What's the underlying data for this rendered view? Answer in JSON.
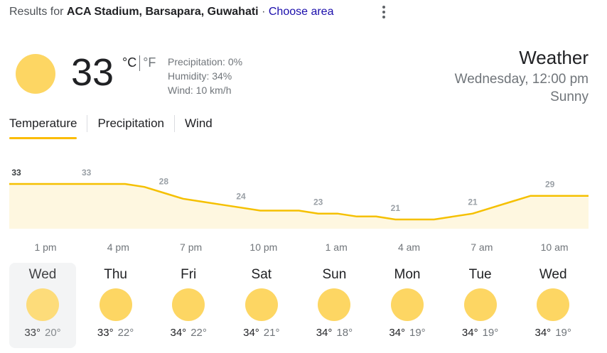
{
  "header": {
    "results_prefix": "Results for",
    "location": "ACA Stadium, Barsapara, Guwahati",
    "separator": "·",
    "choose_area": "Choose area",
    "more_icon": "more-vert-icon"
  },
  "current": {
    "icon": "sun-icon",
    "temperature": "33",
    "unit_c": "°C",
    "unit_f": "°F",
    "precipitation": "Precipitation: 0%",
    "humidity": "Humidity: 34%",
    "wind": "Wind: 10 km/h"
  },
  "summary": {
    "title": "Weather",
    "datetime": "Wednesday, 12:00 pm",
    "condition": "Sunny"
  },
  "tabs": [
    "Temperature",
    "Precipitation",
    "Wind"
  ],
  "chart_data": {
    "type": "area",
    "series": [
      {
        "values": [
          33,
          33,
          33,
          33,
          33,
          33,
          33,
          32,
          30,
          28,
          27,
          26,
          25,
          24,
          24,
          24,
          23,
          23,
          22,
          22,
          21,
          21,
          21,
          22,
          23,
          25,
          27,
          29,
          29,
          29,
          29
        ]
      }
    ],
    "point_labels": [
      {
        "index": 0,
        "label": "33"
      },
      {
        "index": 4,
        "label": "33"
      },
      {
        "index": 8,
        "label": "28"
      },
      {
        "index": 12,
        "label": "24"
      },
      {
        "index": 16,
        "label": "23"
      },
      {
        "index": 20,
        "label": "21"
      },
      {
        "index": 24,
        "label": "21"
      },
      {
        "index": 28,
        "label": "29"
      }
    ],
    "x_labels": [
      "1 pm",
      "4 pm",
      "7 pm",
      "10 pm",
      "1 am",
      "4 am",
      "7 am",
      "10 am"
    ],
    "colors": {
      "line": "#f5c000",
      "fill": "#fef7e0"
    }
  },
  "forecast": [
    {
      "day": "Wed",
      "icon": "sun-icon",
      "high": "33°",
      "low": "20°"
    },
    {
      "day": "Thu",
      "icon": "sun-icon",
      "high": "33°",
      "low": "22°"
    },
    {
      "day": "Fri",
      "icon": "sun-icon",
      "high": "34°",
      "low": "22°"
    },
    {
      "day": "Sat",
      "icon": "sun-icon",
      "high": "34°",
      "low": "21°"
    },
    {
      "day": "Sun",
      "icon": "sun-icon",
      "high": "34°",
      "low": "18°"
    },
    {
      "day": "Mon",
      "icon": "sun-icon",
      "high": "34°",
      "low": "19°"
    },
    {
      "day": "Tue",
      "icon": "sun-icon",
      "high": "34°",
      "low": "19°"
    },
    {
      "day": "Wed",
      "icon": "sun-icon",
      "high": "34°",
      "low": "19°"
    }
  ]
}
